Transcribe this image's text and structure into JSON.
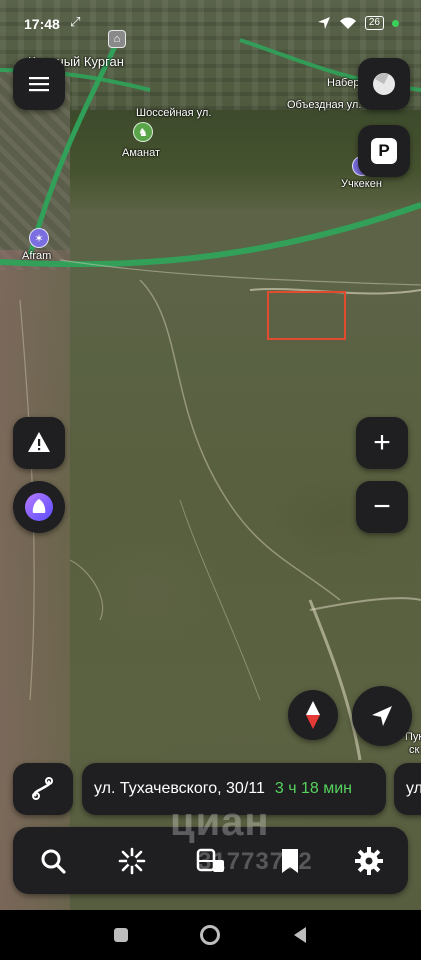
{
  "status_bar": {
    "time": "17:48",
    "battery": "26",
    "icons": [
      "location-arrow-icon",
      "wifi-icon",
      "battery-icon",
      "dot-icon"
    ]
  },
  "map": {
    "labels": {
      "town": "Красный Курган",
      "street_shosseinaya": "Шоссейная ул.",
      "street_naberezhnaya": "Набер",
      "street_obezdnaya": "Объездная ул.",
      "poi_amanat": "Аманат",
      "poi_uchkeken": "Учкекен",
      "poi_afram": "Afram",
      "poi_edge_1": "Пук",
      "poi_edge_2": "ск"
    },
    "accent_road": "#2fa35a",
    "selection_box_color": "#e14b2e"
  },
  "controls": {
    "menu": "menu-icon",
    "layers": "layers-icon",
    "parking": "P",
    "zoom_in": "+",
    "zoom_out": "−",
    "alert": "alert-icon",
    "alice": "alice-icon",
    "compass": "compass-icon",
    "locate": "locate-arrow-icon"
  },
  "route": {
    "destination": "ул. Тухачевского, 30/11",
    "eta": "3 ч 18 мин",
    "peek_label": "ул",
    "eta_color": "#55d35c"
  },
  "toolbar": {
    "items": [
      "search-icon",
      "discover-icon",
      "transport-icon",
      "bookmark-icon",
      "settings-icon"
    ]
  },
  "watermark": {
    "brand": "циан",
    "number": "31773772"
  }
}
